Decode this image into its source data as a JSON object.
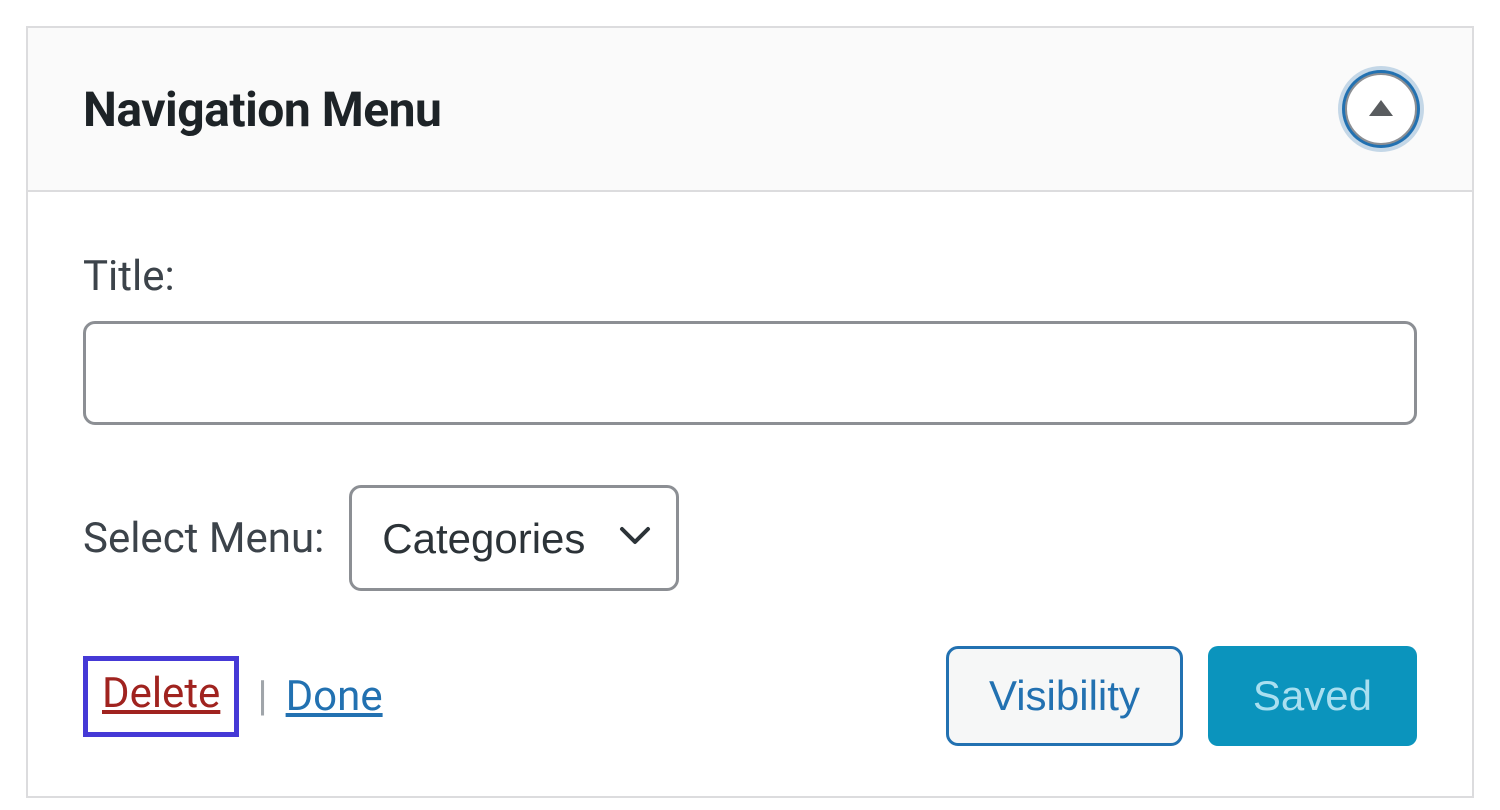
{
  "widget": {
    "title": "Navigation Menu",
    "fields": {
      "title_label": "Title:",
      "title_value": "",
      "select_menu_label": "Select Menu:",
      "select_menu_value": "Categories"
    },
    "actions": {
      "delete_label": "Delete",
      "done_label": "Done",
      "separator": "|",
      "visibility_label": "Visibility",
      "saved_label": "Saved"
    }
  }
}
